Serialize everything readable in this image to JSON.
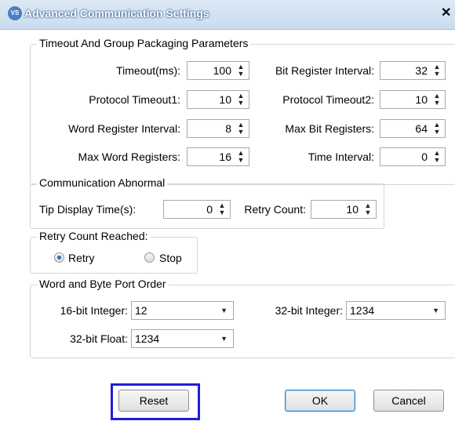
{
  "window": {
    "title": "Advanced Communication Settings",
    "icon_text": "VS"
  },
  "timeout_group": {
    "legend": "Timeout And Group Packaging Parameters",
    "fields": [
      {
        "label": "Timeout(ms):",
        "value": "100"
      },
      {
        "label": "Bit Register Interval:",
        "value": "32"
      },
      {
        "label": "Protocol Timeout1:",
        "value": "10"
      },
      {
        "label": "Protocol Timeout2:",
        "value": "10"
      },
      {
        "label": "Word Register Interval:",
        "value": "8"
      },
      {
        "label": "Max Bit Registers:",
        "value": "64"
      },
      {
        "label": "Max Word Registers:",
        "value": "16"
      },
      {
        "label": "Time Interval:",
        "value": "0"
      }
    ]
  },
  "comm_abnormal": {
    "legend": "Communication Abnormal",
    "tip_label": "Tip Display Time(s):",
    "tip_value": "0",
    "retry_label": "Retry Count:",
    "retry_value": "10"
  },
  "retry_reached": {
    "legend": "Retry Count Reached:",
    "options": [
      {
        "label": "Retry",
        "selected": true
      },
      {
        "label": "Stop",
        "selected": false
      }
    ]
  },
  "port_order": {
    "legend": "Word and Byte Port Order",
    "int16_label": "16-bit Integer:",
    "int16_value": "12",
    "int32_label": "32-bit Integer:",
    "int32_value": "1234",
    "float32_label": "32-bit Float:",
    "float32_value": "1234"
  },
  "buttons": {
    "reset": "Reset",
    "ok": "OK",
    "cancel": "Cancel"
  },
  "colors": {
    "focus_highlight": "#1f1fd6",
    "title_bar": "#c9dcef",
    "radio_selected": "#2a6dc1"
  }
}
